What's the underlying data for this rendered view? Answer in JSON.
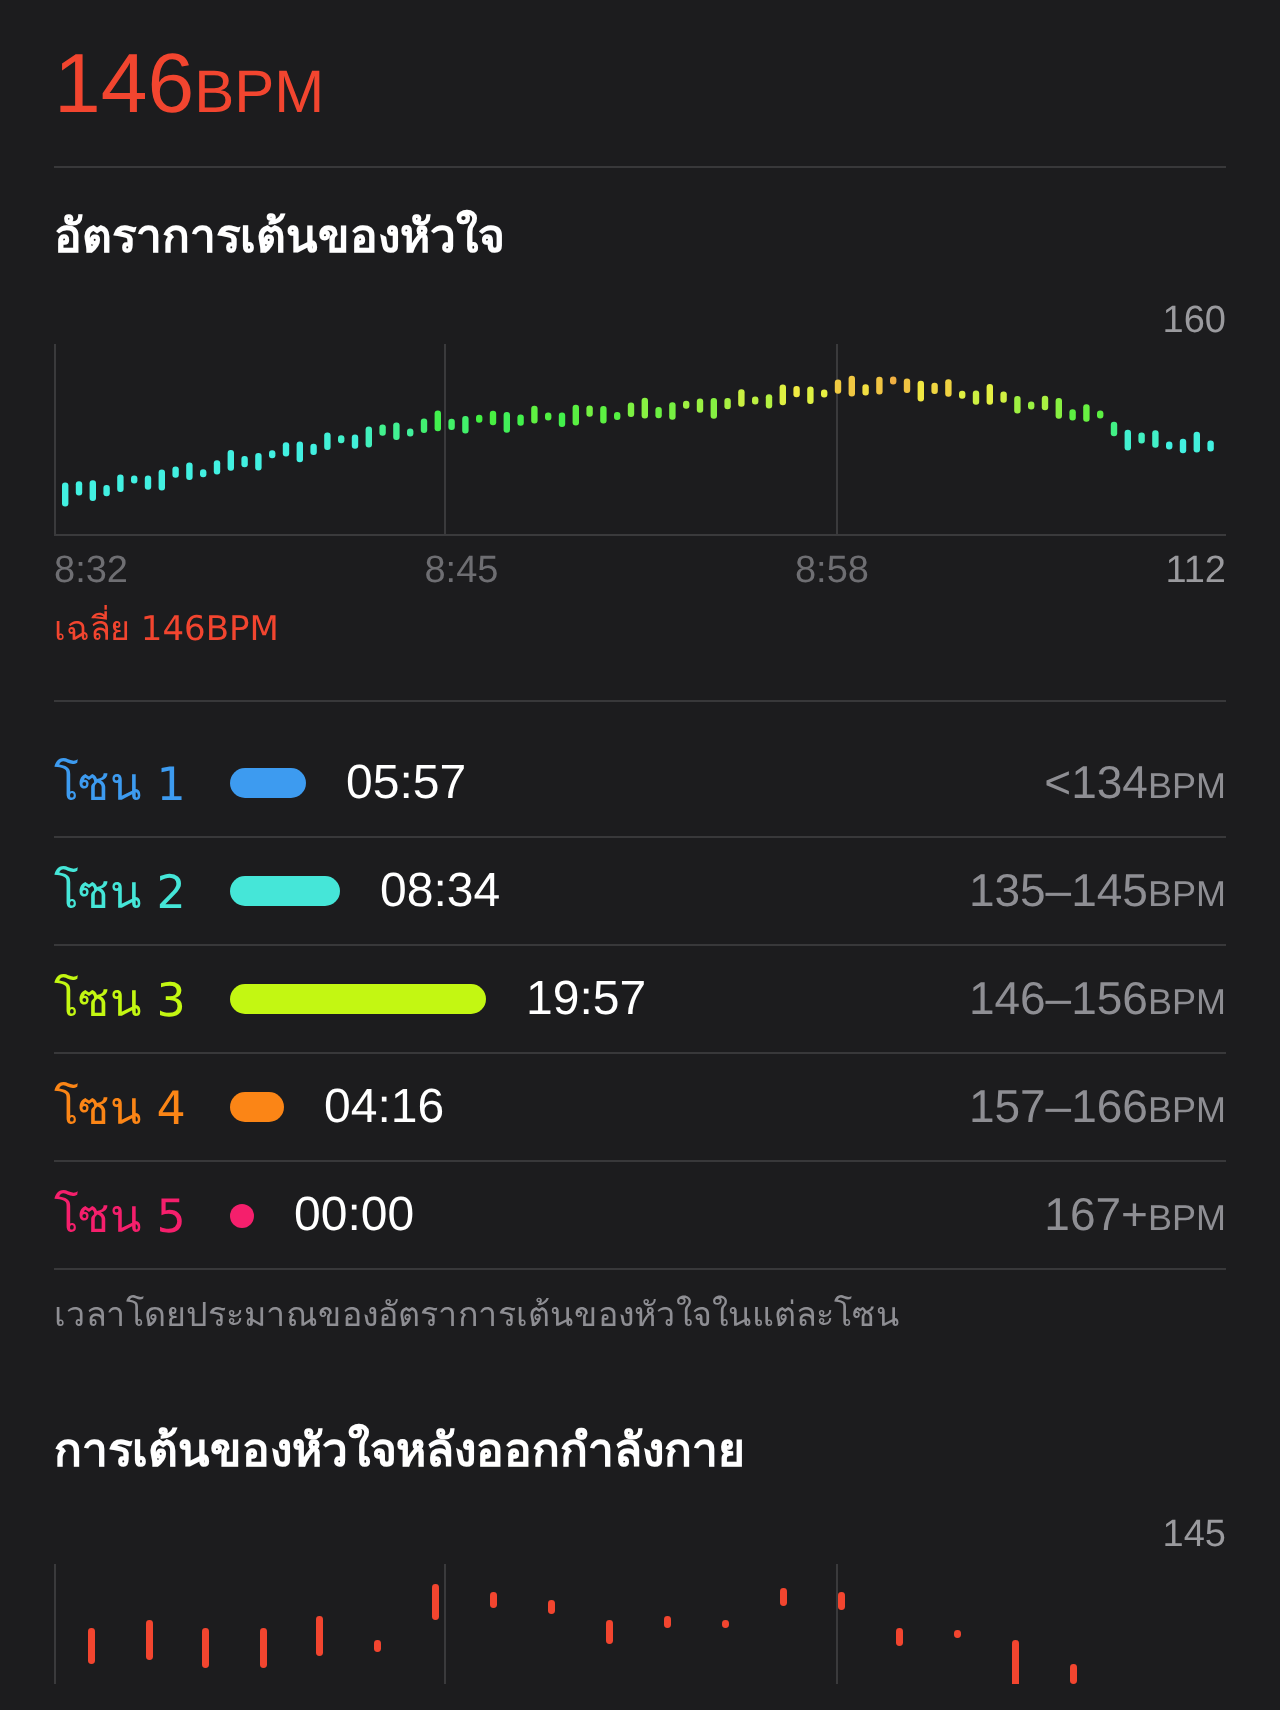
{
  "summary": {
    "value": "146",
    "unit": "BPM"
  },
  "heart_rate": {
    "title": "อัตราการเต้นของหัวใจ",
    "y_max": "160",
    "y_min": "112",
    "x_labels": [
      "8:32",
      "8:45",
      "8:58"
    ],
    "average": "เฉลี่ย 146BPM"
  },
  "zones": [
    {
      "label": "โซน 1",
      "color": "#3d9bf0",
      "time": "05:57",
      "range": "<134",
      "unit": "BPM"
    },
    {
      "label": "โซน 2",
      "color": "#45e6d8",
      "time": "08:34",
      "range": "135–145",
      "unit": "BPM"
    },
    {
      "label": "โซน 3",
      "color": "#c3f712",
      "time": "19:57",
      "range": "146–156",
      "unit": "BPM"
    },
    {
      "label": "โซน 4",
      "color": "#fb8516",
      "time": "04:16",
      "range": "157–166",
      "unit": "BPM"
    },
    {
      "label": "โซน 5",
      "color": "#f51f6c",
      "time": "00:00",
      "range": "167+",
      "unit": "BPM"
    }
  ],
  "zones_note": "เวลาโดยประมาณของอัตราการเต้นของหัวใจในแต่ละโซน",
  "recovery": {
    "title": "การเต้นของหัวใจหลังออกกำลังกาย",
    "y_max": "145"
  }
}
